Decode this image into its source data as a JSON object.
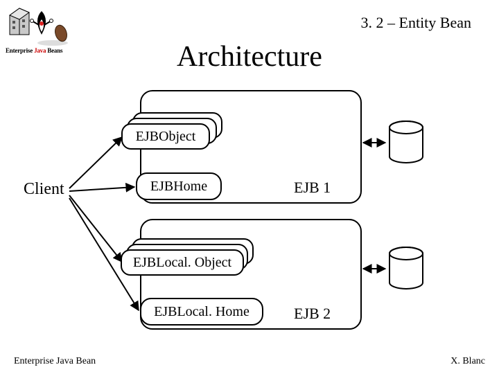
{
  "header": {
    "section": "3. 2 – Entity Bean"
  },
  "title": "Architecture",
  "logo": {
    "caption_a": "Enterprise",
    "caption_b": "Java",
    "caption_c": "Beans"
  },
  "client_label": "Client",
  "ejb": {
    "container1": "EJB 1",
    "container2": "EJB 2",
    "remote_object": "EJBObject",
    "remote_home": "EJBHome",
    "local_object": "EJBLocal. Object",
    "local_home": "EJBLocal. Home"
  },
  "footer": {
    "left": "Enterprise Java Bean",
    "right": "X. Blanc"
  },
  "chart_data": {
    "type": "diagram",
    "title": "Architecture",
    "nodes": [
      {
        "id": "client",
        "label": "Client"
      },
      {
        "id": "ejbobject",
        "label": "EJBObject",
        "multiplicity": 3
      },
      {
        "id": "ejbhome",
        "label": "EJBHome"
      },
      {
        "id": "ejblocalobject",
        "label": "EJBLocal.Object",
        "multiplicity": 3
      },
      {
        "id": "ejblocalhome",
        "label": "EJBLocal.Home"
      },
      {
        "id": "container1",
        "label": "EJB 1",
        "contains": [
          "ejbobject",
          "ejbhome"
        ]
      },
      {
        "id": "container2",
        "label": "EJB 2",
        "contains": [
          "ejblocalobject",
          "ejblocalhome"
        ]
      },
      {
        "id": "db1",
        "label": "datastore 1"
      },
      {
        "id": "db2",
        "label": "datastore 2"
      }
    ],
    "edges": [
      {
        "from": "client",
        "to": "ejbobject"
      },
      {
        "from": "client",
        "to": "ejbhome"
      },
      {
        "from": "client",
        "to": "ejblocalobject"
      },
      {
        "from": "client",
        "to": "ejblocalhome"
      },
      {
        "from": "container1",
        "to": "db1",
        "bidirectional": true
      },
      {
        "from": "container2",
        "to": "db2",
        "bidirectional": true
      }
    ]
  }
}
